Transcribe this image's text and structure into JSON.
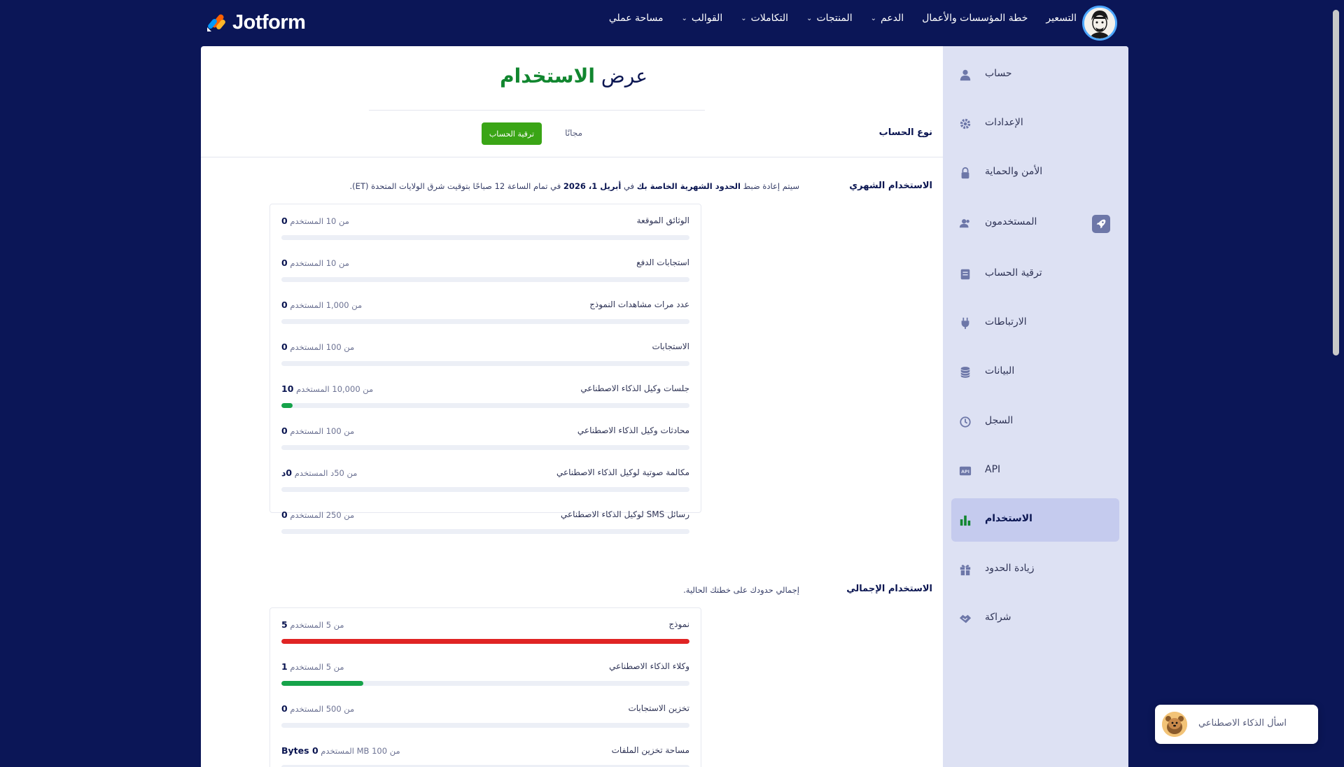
{
  "brand": {
    "name": "Jotform"
  },
  "nav": {
    "items": [
      {
        "label": "التسعير",
        "has_menu": false
      },
      {
        "label": "خطة المؤسسات والأعمال",
        "has_menu": false
      },
      {
        "label": "الدعم",
        "has_menu": true
      },
      {
        "label": "المنتجات",
        "has_menu": true
      },
      {
        "label": "التكاملات",
        "has_menu": true
      },
      {
        "label": "القوالب",
        "has_menu": true
      },
      {
        "label": "مساحة عملي",
        "has_menu": false
      }
    ]
  },
  "sidebar": {
    "items": [
      {
        "label": "حساب",
        "icon": "user-icon"
      },
      {
        "label": "الإعدادات",
        "icon": "gear-icon"
      },
      {
        "label": "الأمن والحماية",
        "icon": "lock-icon"
      },
      {
        "label": "المستخدمون",
        "icon": "users-icon"
      },
      {
        "label": "ترقية الحساب",
        "icon": "upgrade-icon"
      },
      {
        "label": "الارتباطات",
        "icon": "plug-icon"
      },
      {
        "label": "البيانات",
        "icon": "database-icon"
      },
      {
        "label": "السجل",
        "icon": "history-icon"
      },
      {
        "label": "API",
        "icon": "api-icon"
      },
      {
        "label": "الاستخدام",
        "icon": "bar-chart-icon",
        "active": true
      },
      {
        "label": "زيادة الحدود",
        "icon": "gift-icon"
      },
      {
        "label": "شراكة",
        "icon": "handshake-icon"
      }
    ]
  },
  "page": {
    "title_prefix": "عرض",
    "title_accent": "الاستخدام",
    "account_type_label": "نوع الحساب",
    "account_type_value": "مجانًا",
    "upgrade_button": "ترقية الحساب"
  },
  "monthly": {
    "label": "الاستخدام الشهري",
    "note_1": "سيتم إعادة ضبط ",
    "note_bold_1": "الحدود الشهرية الخاصة بك",
    "note_2": " في ",
    "note_bold_2": "أبريل 1، 2026",
    "note_3": " في تمام الساعة 12 صباحًا بتوقيت شرق الولايات المتحدة (ET).",
    "meters": [
      {
        "name": "الوثائق الموقعة",
        "used": "0",
        "suffix": "المستخدم",
        "of": "من 10",
        "fraction": 0
      },
      {
        "name": "استجابات الدفع",
        "used": "0",
        "suffix": "المستخدم",
        "of": "من 10",
        "fraction": 0
      },
      {
        "name": "عدد مرات مشاهدات النموذج",
        "used": "0",
        "suffix": "المستخدم",
        "of": "من 1,000",
        "fraction": 0
      },
      {
        "name": "الاستجابات",
        "used": "0",
        "suffix": "المستخدم",
        "of": "من 100",
        "fraction": 0
      },
      {
        "name": "جلسات وكيل الذكاء الاصطناعي",
        "used": "10",
        "suffix": "المستخدم",
        "of": "من 10,000",
        "fraction": 0.001
      },
      {
        "name": "محادثات وكيل الذكاء الاصطناعي",
        "used": "0",
        "suffix": "المستخدم",
        "of": "من 100",
        "fraction": 0
      },
      {
        "name": "مكالمة صوتية لوكيل الذكاء الاصطناعي",
        "used": "0د",
        "suffix": "المستخدم",
        "of": "من 50د",
        "fraction": 0
      },
      {
        "name": "رسائل SMS لوكيل الذكاء الاصطناعي",
        "used": "0",
        "suffix": "المستخدم",
        "of": "من 250",
        "fraction": 0
      }
    ]
  },
  "total": {
    "label": "الاستخدام الإجمالي",
    "note": "إجمالي حدودك على خطتك الحالية.",
    "meters": [
      {
        "name": "نموذج",
        "used": "5",
        "suffix": "المستخدم",
        "of": "من 5",
        "fraction": 1,
        "color": "#e02424"
      },
      {
        "name": "وكلاء الذكاء الاصطناعي",
        "used": "1",
        "suffix": "المستخدم",
        "of": "من 5",
        "fraction": 0.2,
        "color": "#16a34a"
      },
      {
        "name": "تخزين الاستجابات",
        "used": "0",
        "suffix": "المستخدم",
        "of": "من 500",
        "fraction": 0
      },
      {
        "name": "مساحة تخزين الملفات",
        "used": "0 Bytes",
        "suffix": "المستخدم",
        "of": "من 100 MB",
        "fraction": 0
      }
    ]
  },
  "ask_ai": {
    "label": "اسأل الذكاء الاصطناعي"
  },
  "colors": {
    "navy": "#0b1657",
    "accent_green": "#11862f",
    "button_green": "#3aa516",
    "bar_green": "#16a34a",
    "bar_red": "#e02424",
    "sidebar_bg": "#dde1f3",
    "sidebar_active": "#c5cbee"
  }
}
